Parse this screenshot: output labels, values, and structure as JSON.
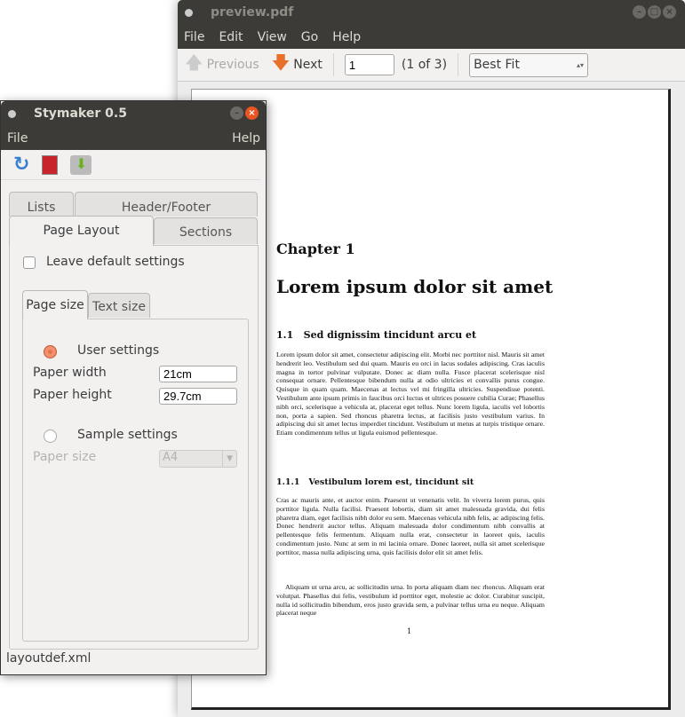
{
  "preview": {
    "title": "preview.pdf",
    "menu": [
      "File",
      "Edit",
      "View",
      "Go",
      "Help"
    ],
    "previous": "Previous",
    "next": "Next",
    "page_value": "1",
    "page_count": "(1 of 3)",
    "zoom": "Best Fit",
    "doc": {
      "chapter": "Chapter 1",
      "chapter_title": "Lorem ipsum dolor sit amet",
      "section": "1.1   Sed dignissim tincidunt arcu et",
      "p1": "Lorem ipsum dolor sit amet, consectetur adipiscing elit. Morbi nec porttitor nisl. Mauris sit amet hendrerit leo. Vestibulum sed dui quam. Mauris eu orci in lacus sodales adipiscing. Cras iaculis magna in tortor pulvinar vulputate. Donec ac diam nulla. Fusce placerat scelerisque nisl consequat ornare. Pellentesque bibendum nulla at odio ultricies et convallis purus congue. Quisque in quam quam. Maecenas at lectus vel mi fringilla ultricies. Suspendisse potenti. Vestibulum ante ipsum primis in faucibus orci luctus et ultrices posuere cubilia Curae; Phasellus nibh orci, scelerisque a vehicula at, placerat eget tellus. Nunc lorem ligula, iaculis vel lobortis non, porta a sapien. Sed rhoncus pharetra lectus, at facilisis justo vestibulum varius. In adipiscing dui sit amet lectus imperdiet tincidunt. Vestibulum ut metus at turpis tristique ornare. Etiam condimentum tellus ut ligula euismod pellentesque.",
      "subsection": "1.1.1   Vestibulum lorem est, tincidunt sit",
      "p2": "Cras ac mauris ante, et auctor enim. Praesent ut venenatis velit. In viverra lorem purus, quis porttitor ligula. Nulla facilisi. Praesent lobortis, diam sit amet malesuada gravida, dui felis pharetra diam, eget facilisis nibh dolor eu sem. Maecenas vehicula nibh felis, ac adipiscing felis. Donec hendrerit auctor tellus. Aliquam malesuada dolor condimentum nibh convallis at pellentesque felis fermentum. Aliquam nulla erat, consectetur in laoreet quis, iaculis condimentum justo. Nunc at sem in mi lacinia ornare. Donec laoreet, nulla sit amet scelerisque porttitor, massa nulla adipiscing urna, quis facilisis dolor elit sit amet felis.",
      "p3": "Aliquam ut urna arcu, ac sollicitudin urna. In porta aliquam diam nec rhoncus. Aliquam erat volutpat. Phasellus dui felis, vestibulum id porttitor eget, molestie ac dolor. Curabitur suscipit, nulla id sollicitudin bibendum, eros justo gravida sem, a pulvinar tellus urna eu neque. Aliquam placerat neque",
      "page_number": "1"
    }
  },
  "stymaker": {
    "title": "Stymaker 0.5",
    "menu_file": "File",
    "menu_help": "Help",
    "tabs_row1": [
      "Lists",
      "Header/Footer"
    ],
    "tabs_row2": [
      "Page Layout",
      "Sections"
    ],
    "leave_default": "Leave default settings",
    "subtabs": [
      "Page size",
      "Text size"
    ],
    "user_settings": "User settings",
    "paper_width_label": "Paper width",
    "paper_width": "21cm",
    "paper_height_label": "Paper height",
    "paper_height": "29.7cm",
    "sample_settings": "Sample settings",
    "paper_size_label": "Paper size",
    "paper_size": "A4",
    "status": "layoutdef.xml",
    "accent": "#e95420"
  }
}
